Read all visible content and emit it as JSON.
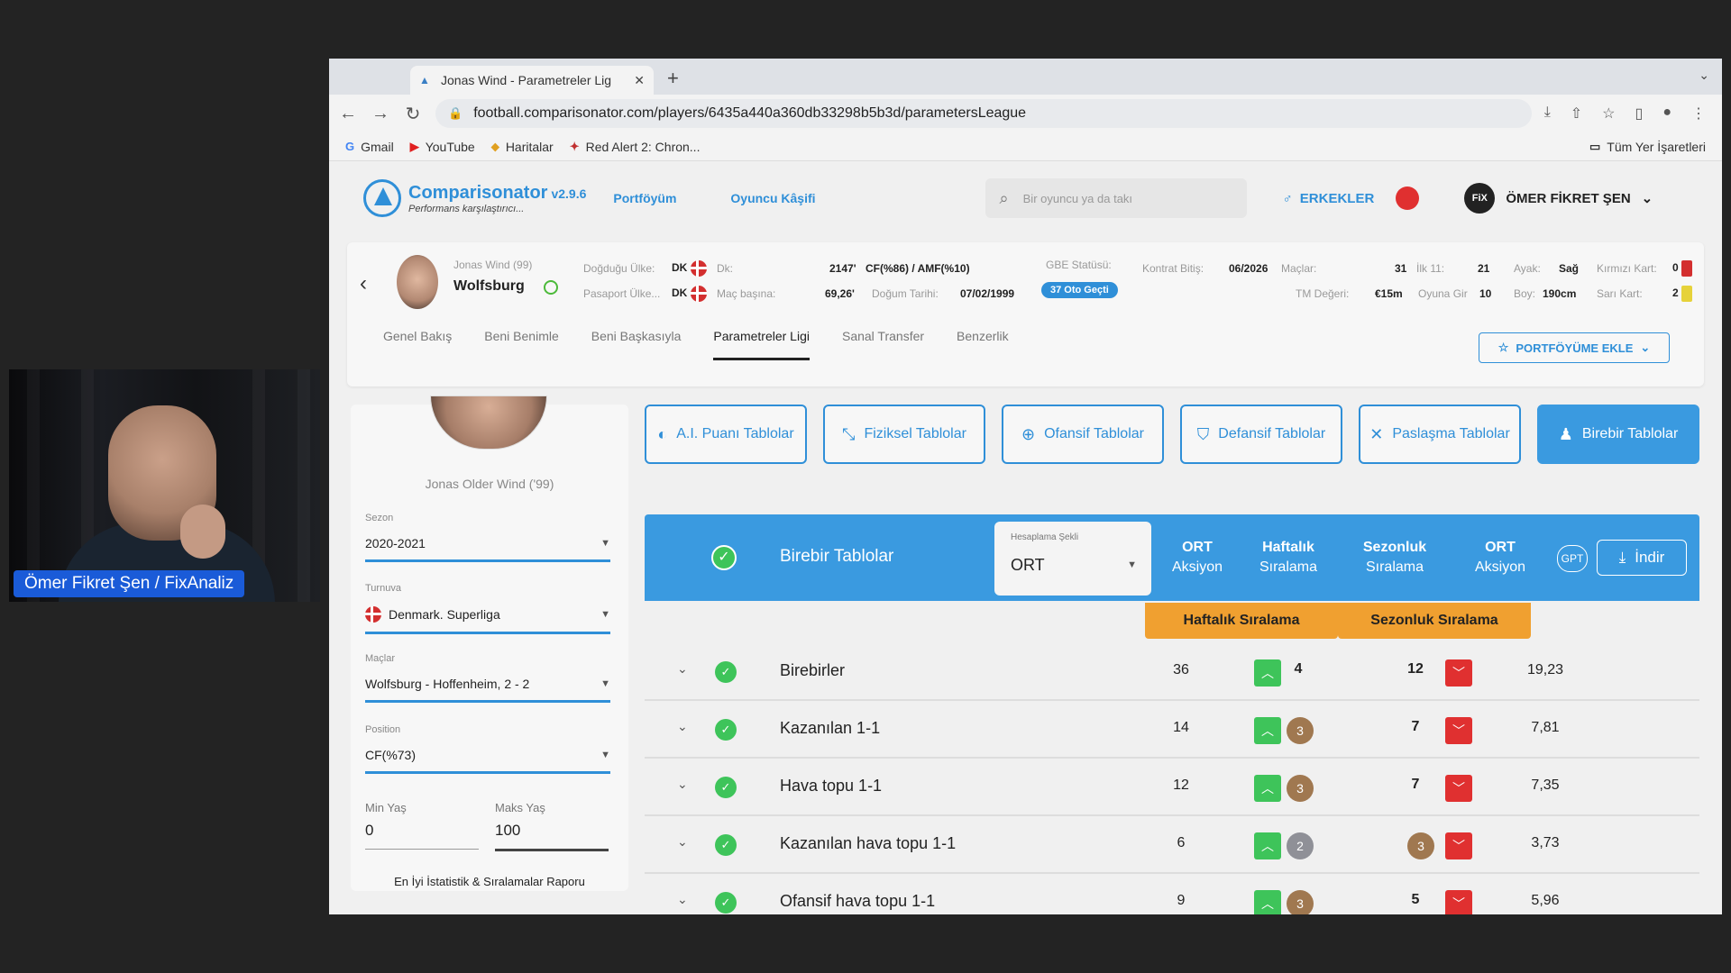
{
  "webcam": {
    "caption": "Ömer Fikret Şen / FixAnaliz"
  },
  "browser": {
    "tab_title": "Jonas Wind - Parametreler Lig",
    "url": "football.comparisonator.com/players/6435a440a360db33298b5b3d/parametersLeague",
    "bookmarks": [
      "Gmail",
      "YouTube",
      "Haritalar",
      "Red Alert 2: Chron..."
    ],
    "bookmarks_right": "Tüm Yer İşaretleri"
  },
  "header": {
    "brand": "Comparisonator",
    "version": "v2.9.6",
    "tagline": "Performans karşılaştırıcı...",
    "nav": [
      "Portföyüm",
      "Oyuncu Kâşifi"
    ],
    "search_placeholder": "Bir oyuncu ya da takı",
    "gender": "ERKEKLER",
    "user_initials": "FiX",
    "user_name": "ÖMER FİKRET ŞEN"
  },
  "player": {
    "name_small": "Jonas Wind (99)",
    "club": "Wolfsburg",
    "birth_country_label": "Doğduğu Ülke:",
    "birth_country": "DK",
    "passport_label": "Pasaport Ülke...",
    "passport": "DK",
    "minutes_label": "Dk:",
    "minutes": "2147'",
    "position": "CF(%86) / AMF(%10)",
    "per_match_label": "Maç başına:",
    "per_match": "69,26'",
    "dob_label": "Doğum Tarihi:",
    "dob": "07/02/1999",
    "gbe_label": "GBE Statüsü:",
    "gbe_value": "37  Oto Geçti",
    "contract_label": "Kontrat Bitiş:",
    "contract": "06/2026",
    "tm_label": "TM Değeri:",
    "tm": "€15m",
    "matches_label": "Maçlar:",
    "matches": "31",
    "first11_label": "İlk 11:",
    "first11": "21",
    "subbed_label": "Oyuna Gir",
    "subbed": "10",
    "foot_label": "Ayak:",
    "foot": "Sağ",
    "height_label": "Boy:",
    "height": "190cm",
    "red_label": "Kırmızı Kart:",
    "red": "0",
    "yellow_label": "Sarı Kart:",
    "yellow": "2"
  },
  "profile_tabs": [
    "Genel Bakış",
    "Beni Benimle",
    "Beni Başkasıyla",
    "Parametreler Ligi",
    "Sanal Transfer",
    "Benzerlik"
  ],
  "add_portfolio": "PORTFÖYÜME EKLE",
  "left_panel": {
    "full_name": "Jonas Older Wind ('99)",
    "season_label": "Sezon",
    "season": "2020-2021",
    "league_label": "Turnuva",
    "league": "Denmark. Superliga",
    "match_label": "Maçlar",
    "match": "Wolfsburg - Hoffenheim, 2 - 2",
    "position_label": "Position",
    "position": "CF(%73)",
    "min_age_label": "Min Yaş",
    "min_age": "0",
    "max_age_label": "Maks Yaş",
    "max_age": "100",
    "report": "En İyi İstatistik & Sıralamalar Raporu"
  },
  "categories": [
    "A.I. Puanı Tablolar",
    "Fiziksel Tablolar",
    "Ofansif Tablolar",
    "Defansif Tablolar",
    "Paslaşma Tablolar",
    "Birebir Tablolar"
  ],
  "table": {
    "title": "Birebir Tablolar",
    "calc_label": "Hesaplama Şekli",
    "calc_value": "ORT",
    "col_ort": "ORT",
    "col_ort_sub": "Aksiyon",
    "col_weekly": "Haftalık",
    "col_weekly_sub": "Sıralama",
    "col_season": "Sezonluk",
    "col_season_sub": "Sıralama",
    "col_avg": "ORT",
    "col_avg_sub": "Aksiyon",
    "gpt": "GPT",
    "download": "İndir",
    "weekly_label": "Haftalık Sıralama",
    "season_label": "Sezonluk Sıralama",
    "rows": [
      {
        "label": "Birebirler",
        "ort": "36",
        "weekly": "4",
        "season": "12",
        "avg": "19,23"
      },
      {
        "label": "Kazanılan 1-1",
        "ort": "14",
        "weekly": "3",
        "season": "7",
        "avg": "7,81"
      },
      {
        "label": "Hava topu 1-1",
        "ort": "12",
        "weekly": "3",
        "season": "7",
        "avg": "7,35"
      },
      {
        "label": "Kazanılan hava topu 1-1",
        "ort": "6",
        "weekly": "2",
        "season": "3",
        "avg": "3,73"
      },
      {
        "label": "Ofansif hava topu 1-1",
        "ort": "9",
        "weekly": "3",
        "season": "5",
        "avg": "5,96"
      }
    ]
  }
}
